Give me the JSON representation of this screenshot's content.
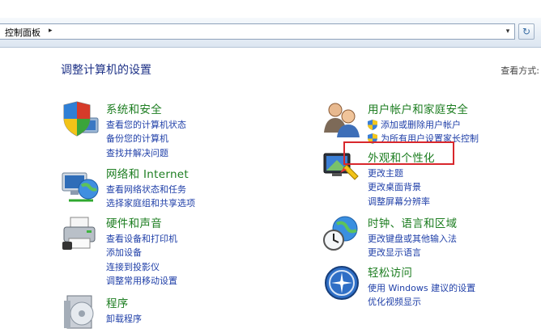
{
  "address": {
    "breadcrumb": "控制面板",
    "arrow": "▸",
    "dropdown": "▾",
    "refresh": "↻"
  },
  "page": {
    "title": "调整计算机的设置",
    "view_by": "查看方式:"
  },
  "categories": {
    "system": {
      "title": "系统和安全",
      "links": [
        "查看您的计算机状态",
        "备份您的计算机",
        "查找并解决问题"
      ]
    },
    "network": {
      "title": "网络和 Internet",
      "links": [
        "查看网络状态和任务",
        "选择家庭组和共享选项"
      ]
    },
    "hardware": {
      "title": "硬件和声音",
      "links": [
        "查看设备和打印机",
        "添加设备",
        "连接到投影仪",
        "调整常用移动设置"
      ]
    },
    "programs": {
      "title": "程序",
      "links": [
        "卸载程序"
      ]
    },
    "users": {
      "title": "用户帐户和家庭安全",
      "links": [
        "添加或删除用户帐户",
        "为所有用户设置家长控制"
      ]
    },
    "appearance": {
      "title": "外观和个性化",
      "links": [
        "更改主题",
        "更改桌面背景",
        "调整屏幕分辨率"
      ]
    },
    "clock": {
      "title": "时钟、语言和区域",
      "links": [
        "更改键盘或其他输入法",
        "更改显示语言"
      ]
    },
    "access": {
      "title": "轻松访问",
      "links": [
        "使用 Windows 建议的设置",
        "优化视频显示"
      ]
    }
  },
  "colors": {
    "category_title": "#1c7d20",
    "link": "#1f3fa8",
    "highlight": "#d8272c"
  }
}
